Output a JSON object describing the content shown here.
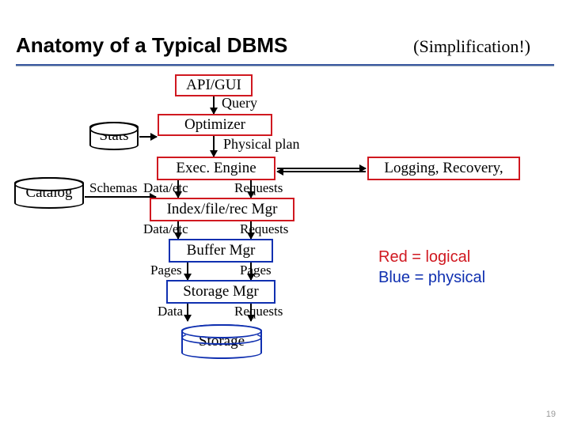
{
  "title": "Anatomy of a Typical DBMS",
  "subtitle": "(Simplification!)",
  "boxes": {
    "api_gui": "API/GUI",
    "optimizer": "Optimizer",
    "exec_engine": "Exec. Engine",
    "index_mgr": "Index/file/rec Mgr",
    "buffer_mgr": "Buffer Mgr",
    "storage_mgr": "Storage Mgr",
    "logging": "Logging, Recovery,"
  },
  "cylinders": {
    "stats": "Stats",
    "catalog": "Catalog",
    "storage": "Storage"
  },
  "labels": {
    "query": "Query",
    "physical_plan": "Physical plan",
    "schemas": "Schemas",
    "data_etc_1": "Data/etc",
    "requests_1": "Requests",
    "data_etc_2": "Data/etc",
    "requests_2": "Requests",
    "pages_1": "Pages",
    "pages_2": "Pages",
    "data": "Data",
    "requests_3": "Requests"
  },
  "legend": {
    "red": "Red = logical",
    "blue": "Blue = physical"
  },
  "page_number": "19"
}
